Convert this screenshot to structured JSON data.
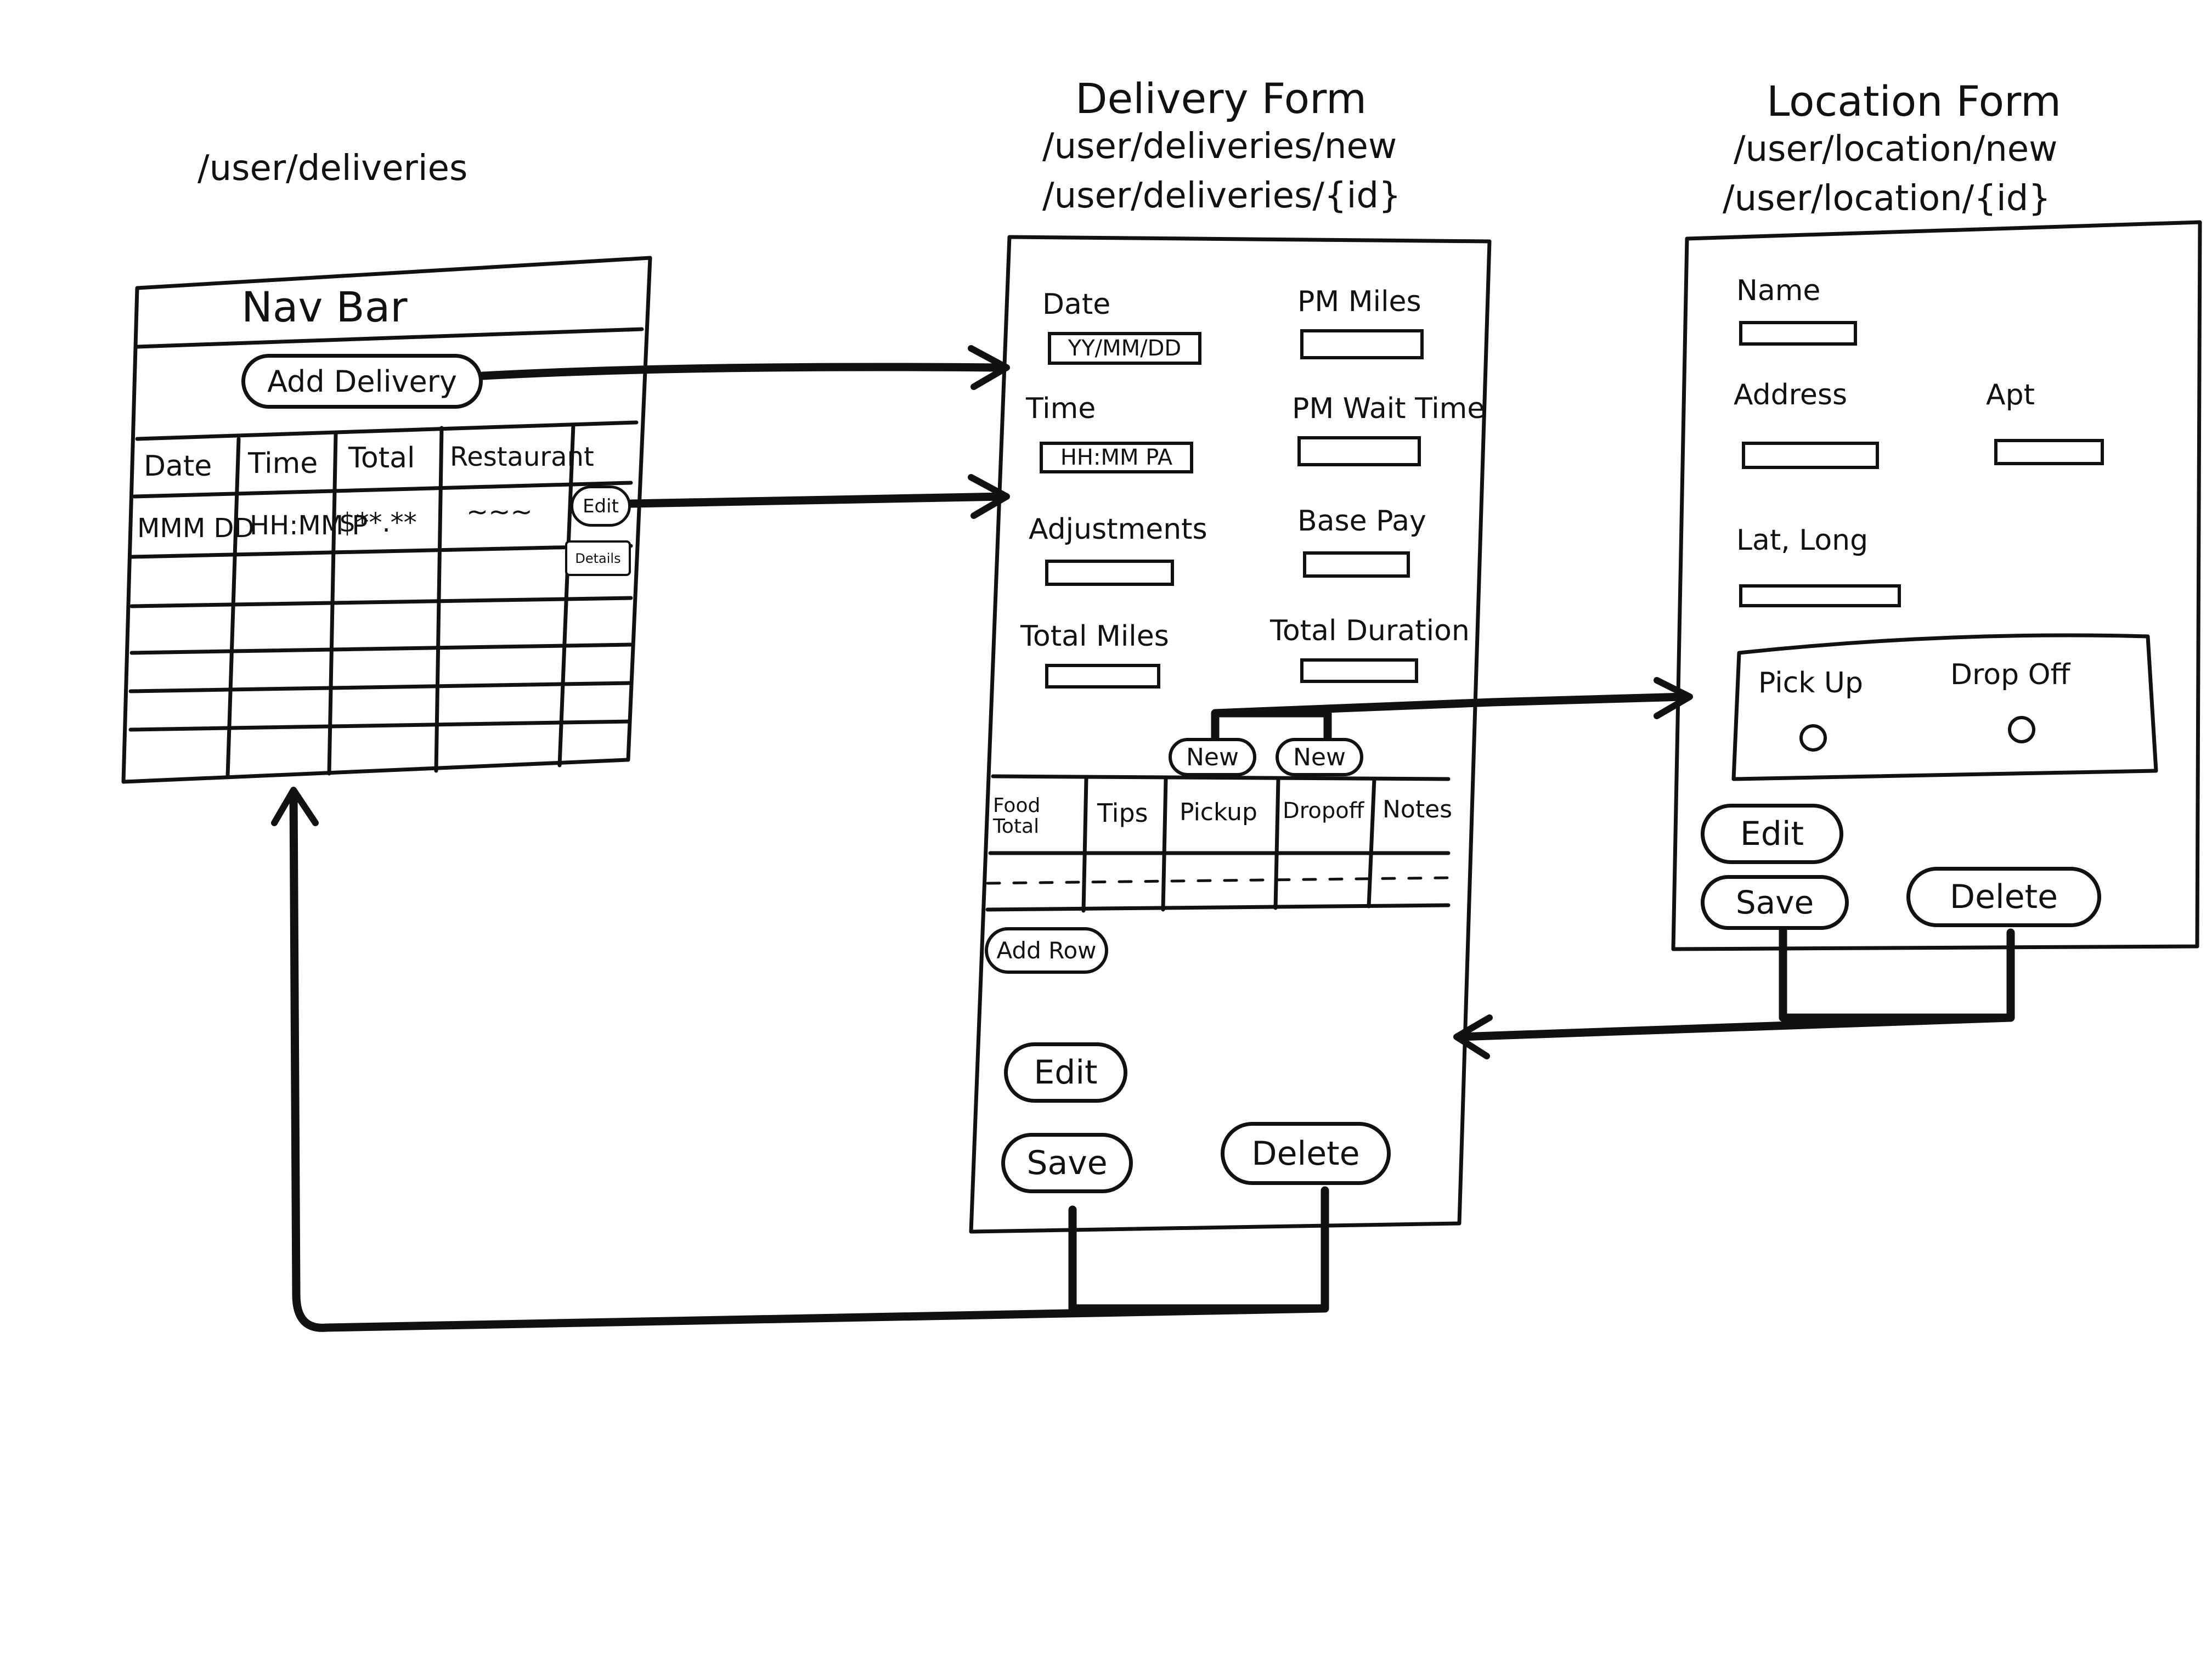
{
  "deliveries_screen": {
    "route": "/user/deliveries",
    "nav_bar": "Nav Bar",
    "add_delivery": "Add Delivery",
    "columns": [
      "Date",
      "Time",
      "Total",
      "Restaurant"
    ],
    "row": {
      "date": "MMM DD",
      "time": "HH:MM P",
      "total": "$**.**",
      "restaurant": "~~~"
    },
    "edit": "Edit",
    "details": "Details"
  },
  "delivery_form": {
    "title": "Delivery Form",
    "route_new": "/user/deliveries/new",
    "route_id": "/user/deliveries/{id}",
    "date_label": "Date",
    "date_placeholder": "YY/MM/DD",
    "time_label": "Time",
    "time_placeholder": "HH:MM PA",
    "pm_miles": "PM Miles",
    "pm_wait_time": "PM Wait Time",
    "adjustments": "Adjustments",
    "base_pay": "Base Pay",
    "total_miles": "Total Miles",
    "total_duration": "Total Duration",
    "new_button": "New",
    "table_headers": [
      "Food Total",
      "Tips",
      "Pickup",
      "Dropoff",
      "Notes"
    ],
    "add_row": "Add Row",
    "edit": "Edit",
    "save": "Save",
    "delete": "Delete"
  },
  "location_form": {
    "title": "Location Form",
    "route_new": "/user/location/new",
    "route_id": "/user/location/{id}",
    "name": "Name",
    "address": "Address",
    "apt": "Apt",
    "lat_long": "Lat, Long",
    "pick_up": "Pick Up",
    "drop_off": "Drop Off",
    "edit": "Edit",
    "save": "Save",
    "delete": "Delete"
  }
}
